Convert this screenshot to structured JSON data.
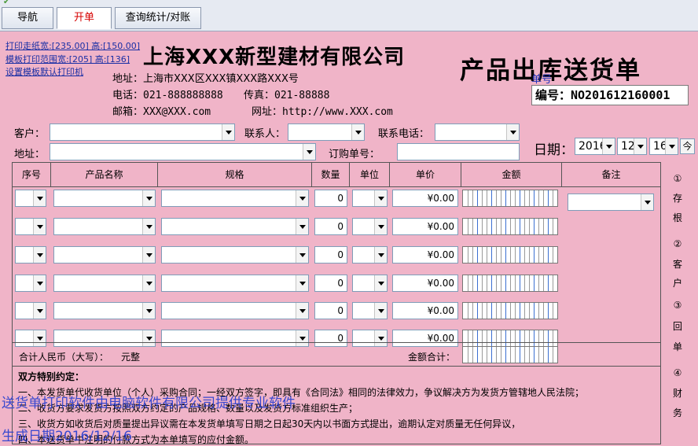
{
  "tabs": [
    {
      "label": "导航"
    },
    {
      "label": "开单"
    },
    {
      "label": "查询统计/对账"
    }
  ],
  "print_links": [
    "打印走纸宽:[235.00] 高:[150.00]",
    "模板打印范围宽:[205] 高:[136]",
    "设置模板默认打印机"
  ],
  "company": {
    "name": "上海XXX新型建材有限公司",
    "address": "地址：上海市XXX区XXX镇XXX路XXX号",
    "phone": "电话：021-888888888",
    "fax": "传真：021-88888",
    "email": "邮箱：XXX@XXX.com",
    "website": "网址：http://www.XXX.com"
  },
  "document": {
    "title": "产品出库送货单",
    "number_label": "单号",
    "number": "编号：NO201612160001"
  },
  "form": {
    "customer_label": "客户：",
    "contact_label": "联系人：",
    "phone_label": "联系电话：",
    "address_label": "地址：",
    "order_label": "订购单号：",
    "date_label": "日期：",
    "date_year": "2016",
    "date_month": "12",
    "date_day": "16",
    "today_button": "今"
  },
  "table": {
    "headers": [
      "序号",
      "产品名称",
      "规格",
      "数量",
      "单位",
      "单价",
      "金额",
      "备注"
    ],
    "rows": [
      {
        "quantity": "0",
        "price": "¥0.00"
      },
      {
        "quantity": "0",
        "price": "¥0.00"
      },
      {
        "quantity": "0",
        "price": "¥0.00"
      },
      {
        "quantity": "0",
        "price": "¥0.00"
      },
      {
        "quantity": "0",
        "price": "¥0.00"
      },
      {
        "quantity": "0",
        "price": "¥0.00"
      }
    ],
    "total_rmb_label": "合计人民币（大写）：",
    "total_rmb_value": "元整",
    "total_amount_label": "金额合计："
  },
  "terms": {
    "title": "双方特别约定：",
    "lines": [
      "一、本发货单代收货单位（个人）采购合同；一经双方签字，即具有《合同法》相同的法律效力，争议解决方为发货方管辖地人民法院；",
      "二、收货方要求发货方按照双方约定的产品规格、数量以及发货方标准组织生产；",
      "三、收货方如收货后对质量提出异议需在本发货单填写日期之日起30天内以书面方式提出，逾期认定对质量无任何异议，",
      "四、本送货单中注明的付款方式为本单填写的应付金额。"
    ]
  },
  "side_copies": [
    "①",
    "存",
    "根",
    "②",
    "客",
    "户",
    "③",
    "回",
    "单",
    "④",
    "财",
    "务"
  ],
  "watermark": {
    "line1": "送货单打印软件由电脑软件有限公司提供专业软件",
    "line2": "生成日期2016/12/16"
  },
  "colors": {
    "form_bg": "#f0b4c8",
    "link": "#1a2fa5",
    "watermark": "#2a3fd0"
  }
}
